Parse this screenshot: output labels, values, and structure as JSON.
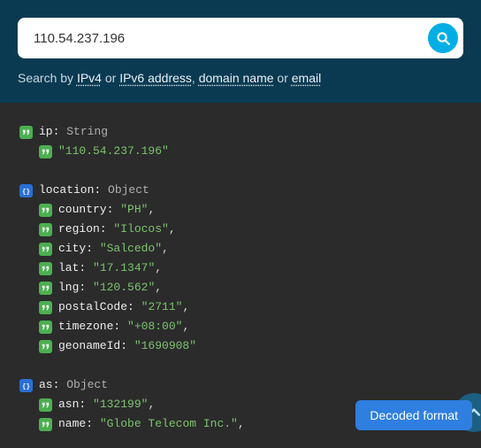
{
  "search": {
    "value": "110.54.237.196",
    "placeholder": "",
    "hint_prefix": "Search by ",
    "hint_ipv4": "IPv4",
    "hint_or1": " or ",
    "hint_ipv6": "IPv6 address",
    "hint_sep1": ", ",
    "hint_domain": "domain name",
    "hint_or2": " or ",
    "hint_email": "email"
  },
  "decoded_label": "Decoded format",
  "code": {
    "lines": [
      {
        "indent": 0,
        "kind": "str-type",
        "key": "ip",
        "type": "String"
      },
      {
        "indent": 1,
        "kind": "val-only",
        "key": "",
        "val": "\"110.54.237.196\""
      },
      {
        "spacer": true
      },
      {
        "indent": 0,
        "kind": "obj-type",
        "key": "location",
        "type": "Object"
      },
      {
        "indent": 1,
        "kind": "kv",
        "key": "country",
        "val": "\"PH\"",
        "trail": ","
      },
      {
        "indent": 1,
        "kind": "kv",
        "key": "region",
        "val": "\"Ilocos\"",
        "trail": ","
      },
      {
        "indent": 1,
        "kind": "kv",
        "key": "city",
        "val": "\"Salcedo\"",
        "trail": ","
      },
      {
        "indent": 1,
        "kind": "kv",
        "key": "lat",
        "val": "\"17.1347\"",
        "trail": ","
      },
      {
        "indent": 1,
        "kind": "kv",
        "key": "lng",
        "val": "\"120.562\"",
        "trail": ","
      },
      {
        "indent": 1,
        "kind": "kv",
        "key": "postalCode",
        "val": "\"2711\"",
        "trail": ","
      },
      {
        "indent": 1,
        "kind": "kv",
        "key": "timezone",
        "val": "\"+08:00\"",
        "trail": ","
      },
      {
        "indent": 1,
        "kind": "kv",
        "key": "geonameId",
        "val": "\"1690908\"",
        "trail": ""
      },
      {
        "spacer": true
      },
      {
        "indent": 0,
        "kind": "obj-type",
        "key": "as",
        "type": "Object"
      },
      {
        "indent": 1,
        "kind": "kv",
        "key": "asn",
        "val": "\"132199\"",
        "trail": ","
      },
      {
        "indent": 1,
        "kind": "kv",
        "key": "name",
        "val": "\"Globe Telecom Inc.\"",
        "trail": ","
      }
    ]
  }
}
